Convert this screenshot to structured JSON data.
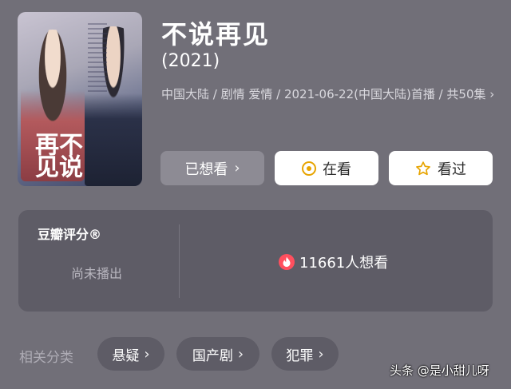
{
  "poster": {
    "calligraphy": "不说再见"
  },
  "movie": {
    "title": "不说再见",
    "year": "(2021)",
    "meta": "中国大陆 / 剧情 爱情 / 2021-06-22(中国大陆)首播 / 共50集 ›"
  },
  "actions": {
    "wish_label": "已想看",
    "watching_label": "在看",
    "watched_label": "看过",
    "chevron": "›"
  },
  "rating": {
    "title": "豆瓣评分®",
    "status": "尚未播出",
    "want_count": "11661人想看"
  },
  "related": {
    "label": "相关分类",
    "tags": [
      "悬疑",
      "国产剧",
      "犯罪"
    ]
  },
  "watermark": "头条 @是小甜儿呀",
  "colors": {
    "accent": "#e7a400",
    "fire": "#ff4f5e",
    "background": "#716f78",
    "card": "#5e5c66"
  },
  "icons": {
    "watching": "ring-icon",
    "watched": "star-icon",
    "want": "fire-icon"
  }
}
